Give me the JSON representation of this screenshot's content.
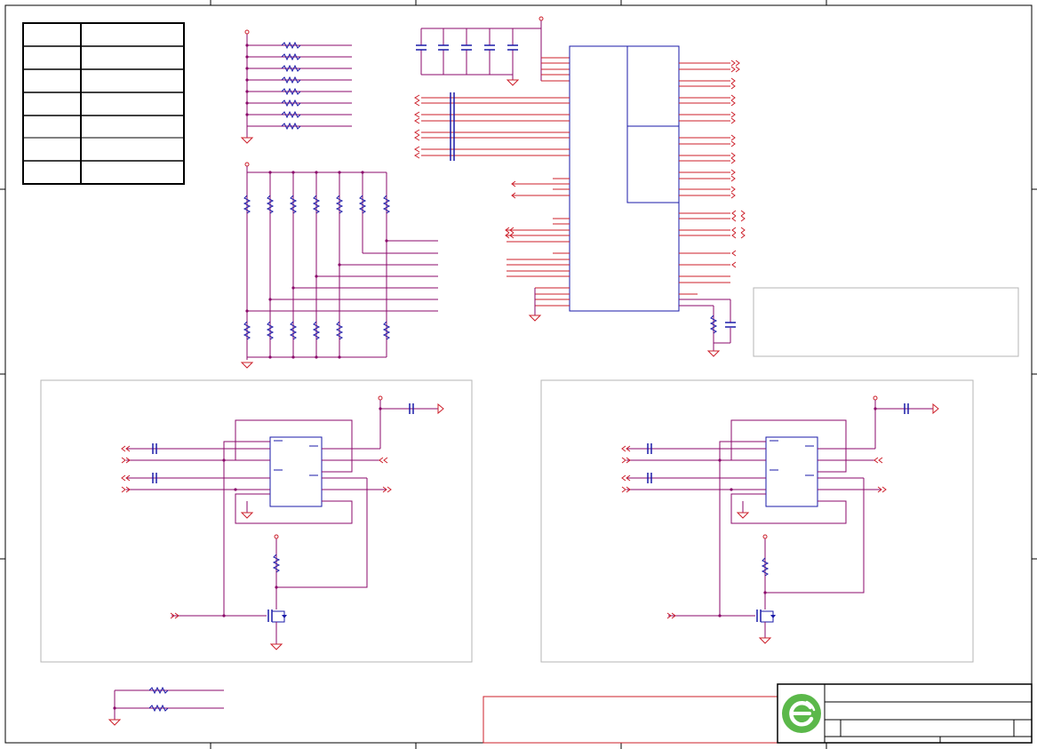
{
  "sheet": {
    "line_color": "#8b0a6b",
    "wire_color": "#cc1f2a",
    "part_color": "#1a1aa8",
    "frame_color": "#000000",
    "region_color": "#b5b5b5"
  },
  "revision_table": {
    "rows": 7,
    "cols": 2
  },
  "title_block": {
    "logo_icon": "company-logo-icon",
    "logo_color": "#5bb84a"
  }
}
